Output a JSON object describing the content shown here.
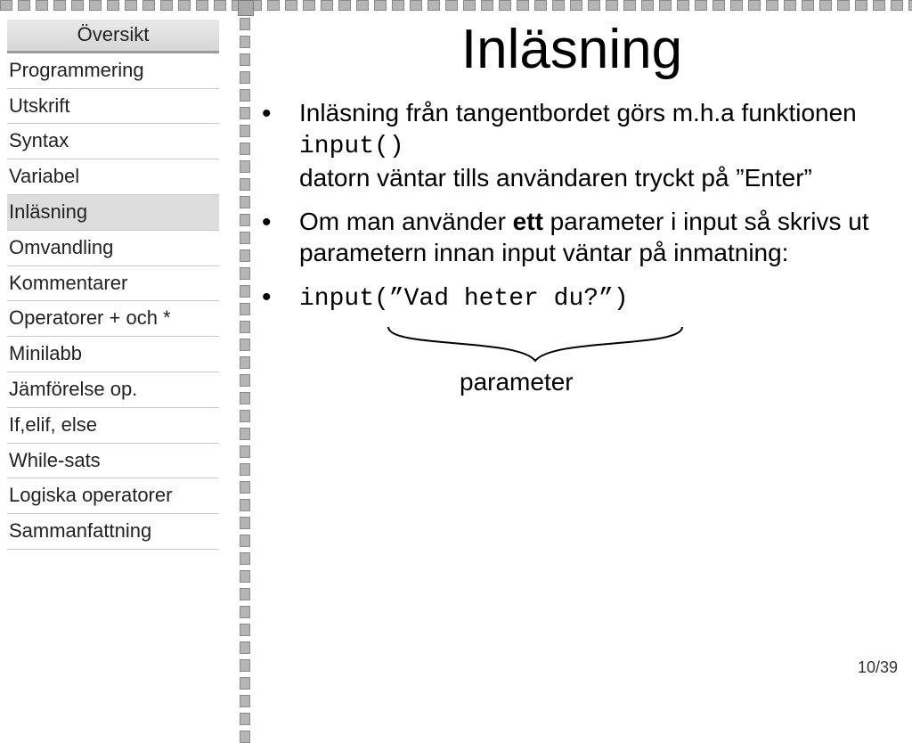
{
  "sidebar": {
    "items": [
      {
        "label": "Översikt",
        "class": "header"
      },
      {
        "label": "Programmering",
        "class": ""
      },
      {
        "label": "Utskrift",
        "class": ""
      },
      {
        "label": "Syntax",
        "class": ""
      },
      {
        "label": "Variabel",
        "class": ""
      },
      {
        "label": "Inläsning",
        "class": "active"
      },
      {
        "label": "Omvandling",
        "class": ""
      },
      {
        "label": "Kommentarer",
        "class": ""
      },
      {
        "label": "Operatorer + och *",
        "class": ""
      },
      {
        "label": "Minilabb",
        "class": ""
      },
      {
        "label": "Jämförelse op.",
        "class": ""
      },
      {
        "label": "If,elif, else",
        "class": ""
      },
      {
        "label": "While-sats",
        "class": ""
      },
      {
        "label": "Logiska operatorer",
        "class": ""
      },
      {
        "label": "Sammanfattning",
        "class": ""
      }
    ]
  },
  "slide": {
    "title": "Inläsning",
    "b1_line1": "Inläsning från tangentbordet görs m.h.a funktionen",
    "b1_code": "input()",
    "b1_line2_a": "datorn väntar tills användaren tryckt på ",
    "b1_line2_q": "”Enter”",
    "b2_a": "Om man använder ",
    "b2_bold": "ett",
    "b2_b": " parameter i input så skrivs ut parametern innan input väntar på inmatning:",
    "b3_code": "input(”Vad heter du?”)",
    "brace_label": "parameter",
    "page": "10/39"
  }
}
